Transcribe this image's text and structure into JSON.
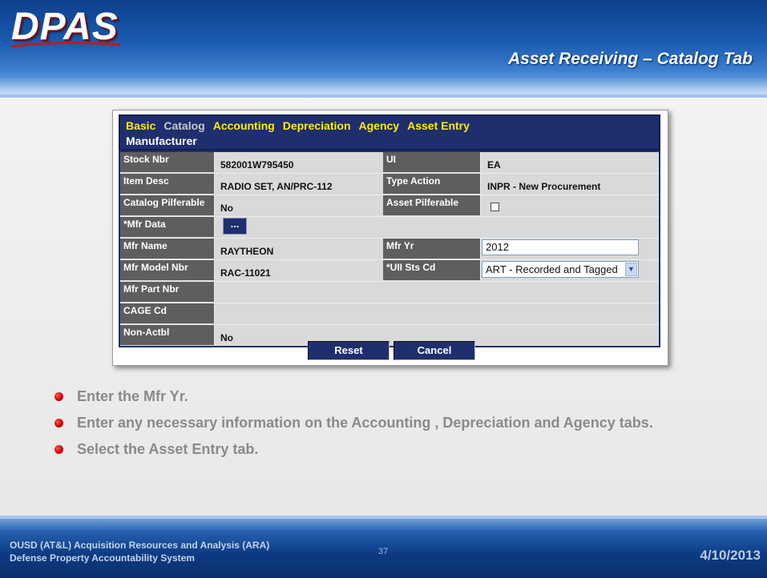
{
  "logo": "DPAS",
  "slide_title": "Asset Receiving – Catalog Tab",
  "tabs": [
    "Basic",
    "Catalog",
    "Accounting",
    "Depreciation",
    "Agency",
    "Asset Entry"
  ],
  "active_tab": "Catalog",
  "section_title": "Manufacturer",
  "rows": {
    "stock_nbr": {
      "label": "Stock Nbr",
      "value": "582001W795450"
    },
    "ui": {
      "label": "UI",
      "value": "EA"
    },
    "item_desc": {
      "label": "Item Desc",
      "value": "RADIO SET, AN/PRC-112"
    },
    "type_action": {
      "label": "Type Action",
      "value": "INPR - New Procurement"
    },
    "catalog_pilferable": {
      "label": "Catalog Pilferable",
      "value": "No"
    },
    "asset_pilferable": {
      "label": "Asset Pilferable",
      "checked": false
    },
    "mfr_data": {
      "label": "*Mfr Data",
      "button": "..."
    },
    "mfr_name": {
      "label": "Mfr Name",
      "value": "RAYTHEON"
    },
    "mfr_yr": {
      "label": "Mfr Yr",
      "value": "2012"
    },
    "mfr_model_nbr": {
      "label": "Mfr Model Nbr",
      "value": "RAC-11021"
    },
    "uii_sts_cd": {
      "label": "*UII Sts Cd",
      "value": "ART - Recorded and Tagged"
    },
    "mfr_part_nbr": {
      "label": "Mfr Part Nbr",
      "value": ""
    },
    "cage_cd": {
      "label": "CAGE Cd",
      "value": ""
    },
    "non_actbl": {
      "label": "Non-Actbl",
      "value": "No"
    }
  },
  "buttons": {
    "reset": "Reset",
    "cancel": "Cancel"
  },
  "bullets": [
    "Enter the Mfr Yr.",
    "Enter any necessary information on the Accounting , Depreciation and Agency tabs.",
    "Select the Asset Entry tab."
  ],
  "footer": {
    "org_line1": "OUSD (AT&L) Acquisition Resources and Analysis (ARA)",
    "org_line2": "Defense Property Accountability System",
    "page_number": "37",
    "date": "4/10/2013"
  },
  "colors": {
    "header_blue": "#1a5cb0",
    "tab_yellow": "#ffef00",
    "app_navy": "#1f2e6e",
    "bullet_red": "#d40000"
  }
}
